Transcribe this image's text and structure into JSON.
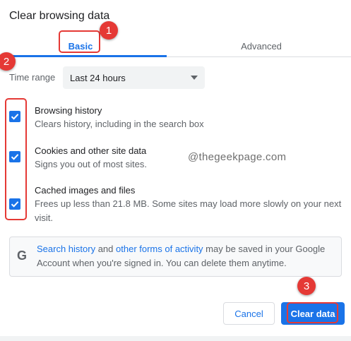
{
  "dialog": {
    "title": "Clear browsing data"
  },
  "tabs": [
    {
      "label": "Basic",
      "active": true
    },
    {
      "label": "Advanced",
      "active": false
    }
  ],
  "time_range": {
    "label": "Time range",
    "selected": "Last 24 hours"
  },
  "items": [
    {
      "title": "Browsing history",
      "desc": "Clears history, including in the search box",
      "checked": true
    },
    {
      "title": "Cookies and other site data",
      "desc": "Signs you out of most sites.",
      "checked": true
    },
    {
      "title": "Cached images and files",
      "desc_line1": "Frees up less than 21.8 MB. Some sites may load more slowly on your next",
      "desc_line2": "visit.",
      "checked": true
    }
  ],
  "info": {
    "link1": "Search history",
    "mid1": " and ",
    "link2": "other forms of activity",
    "rest1": " may be saved in your Google",
    "line2": "Account when you're signed in. You can delete them anytime."
  },
  "buttons": {
    "cancel": "Cancel",
    "clear": "Clear data"
  },
  "watermark": "@thegeekpage.com",
  "annotations": {
    "badge1": "1",
    "badge2": "2",
    "badge3": "3"
  },
  "colors": {
    "accent": "#1a73e8",
    "annotation": "#e53935"
  }
}
